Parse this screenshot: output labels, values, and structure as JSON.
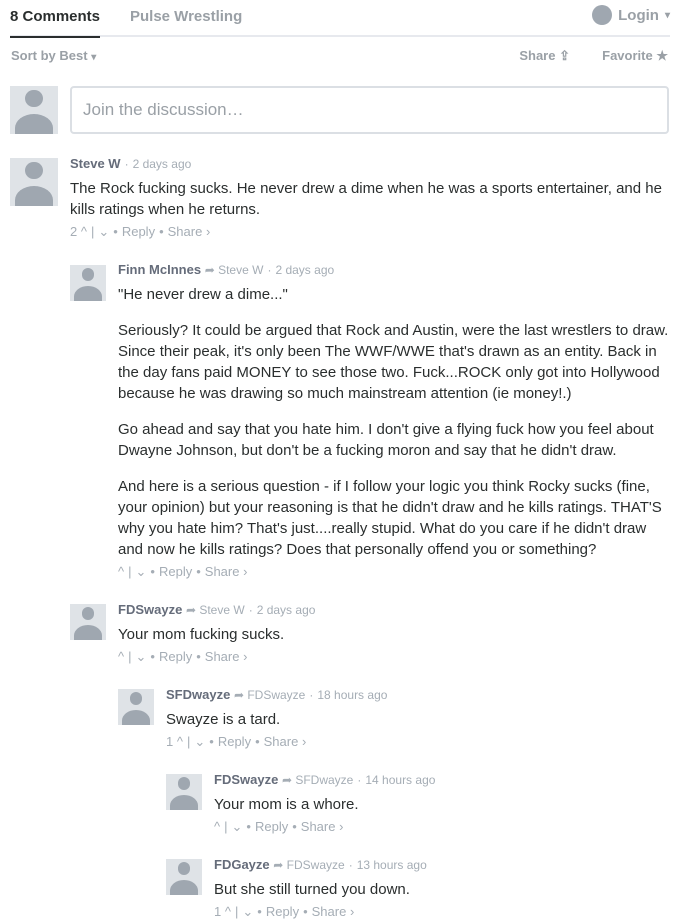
{
  "nav": {
    "comments_tab": "8 Comments",
    "community_tab": "Pulse Wrestling",
    "login": "Login"
  },
  "sortbar": {
    "sort_label": "Sort by Best",
    "share_label": "Share",
    "favorite_label": "Favorite"
  },
  "join": {
    "placeholder": "Join the discussion…"
  },
  "icons": {
    "caret": "▾",
    "share": "⇪",
    "star": "★",
    "arrow": "➦",
    "up": "^",
    "down": "⌄",
    "chevron": "›"
  },
  "colors": {
    "text": "#2a2e2e",
    "muted": "#9aa0a6",
    "author": "#656c7a",
    "avatar": "#9fa7b0"
  },
  "actions": {
    "reply": "Reply",
    "share": "Share"
  },
  "comments": [
    {
      "author": "Steve W",
      "parent": "",
      "time": "2 days ago",
      "paragraphs": [
        "The Rock fucking sucks. He never drew a dime when he was a sports entertainer, and he kills ratings when he returns."
      ],
      "votes": "2"
    },
    {
      "author": "Finn McInnes",
      "parent": "Steve W",
      "time": "2 days ago",
      "paragraphs": [
        "\"He never drew a dime...\"",
        "Seriously? It could be argued that Rock and Austin, were the last wrestlers to draw. Since their peak, it's only been The WWF/WWE that's drawn as an entity. Back in the day fans paid MONEY to see those two. Fuck...ROCK only got into Hollywood because he was drawing so much mainstream attention (ie money!.)",
        "Go ahead and say that you hate him. I don't give a flying fuck how you feel about Dwayne Johnson, but don't be a fucking moron and say that he didn't draw.",
        "And here is a serious question - if I follow your logic you think Rocky sucks (fine, your opinion) but your reasoning is that he didn't draw and he kills ratings. THAT'S why you hate him? That's just....really stupid. What do you care if he didn't draw and now he kills ratings? Does that personally offend you or something?"
      ],
      "votes": ""
    },
    {
      "author": "FDSwayze",
      "parent": "Steve W",
      "time": "2 days ago",
      "paragraphs": [
        "Your mom fucking sucks."
      ],
      "votes": ""
    },
    {
      "author": "SFDwayze",
      "parent": "FDSwayze",
      "time": "18 hours ago",
      "paragraphs": [
        "Swayze is a tard."
      ],
      "votes": "1"
    },
    {
      "author": "FDSwayze",
      "parent": "SFDwayze",
      "time": "14 hours ago",
      "paragraphs": [
        "Your mom is a whore."
      ],
      "votes": ""
    },
    {
      "author": "FDGayze",
      "parent": "FDSwayze",
      "time": "13 hours ago",
      "paragraphs": [
        "But she still turned you down."
      ],
      "votes": "1"
    }
  ]
}
